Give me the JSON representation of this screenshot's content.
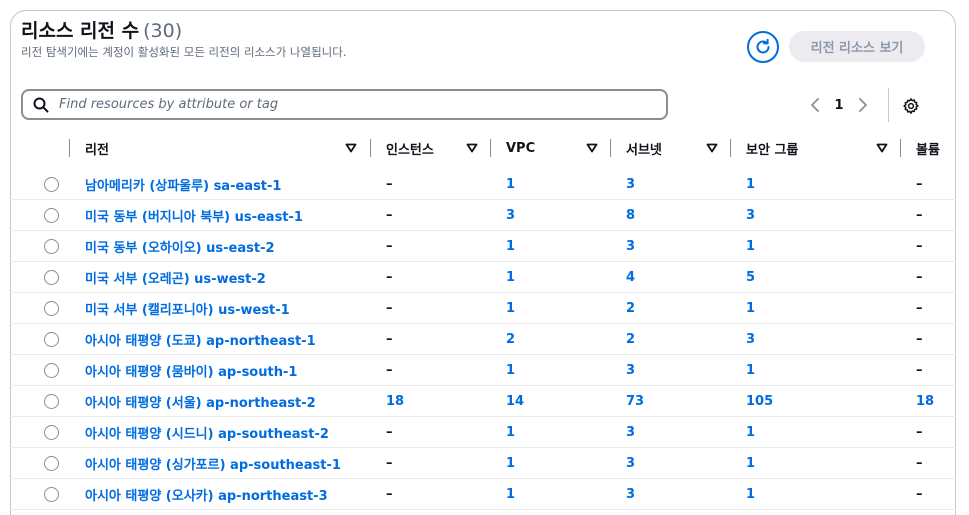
{
  "header": {
    "title": "리소스 리전 수",
    "count": "(30)",
    "description": "리전 탐색기에는 계정이 활성화된 모든 리전의 리소스가 나열됩니다.",
    "view_button_label": "리전 리소스 보기"
  },
  "search": {
    "placeholder": "Find resources by attribute or tag",
    "value": ""
  },
  "pagination": {
    "current_page": "1"
  },
  "colors": {
    "link": "#006ce0",
    "disabled_button_bg": "#ebebf0"
  },
  "table": {
    "columns": [
      "리전",
      "인스턴스",
      "VPC",
      "서브넷",
      "보안 그룹",
      "볼륨"
    ],
    "rows": [
      {
        "region": "남아메리카 (상파울루) sa-east-1",
        "instances": "–",
        "vpc": "1",
        "subnets": "3",
        "security_groups": "1",
        "volumes": "–"
      },
      {
        "region": "미국 동부 (버지니아 북부) us-east-1",
        "instances": "–",
        "vpc": "3",
        "subnets": "8",
        "security_groups": "3",
        "volumes": "–"
      },
      {
        "region": "미국 동부 (오하이오) us-east-2",
        "instances": "–",
        "vpc": "1",
        "subnets": "3",
        "security_groups": "1",
        "volumes": "–"
      },
      {
        "region": "미국 서부 (오레곤) us-west-2",
        "instances": "–",
        "vpc": "1",
        "subnets": "4",
        "security_groups": "5",
        "volumes": "–"
      },
      {
        "region": "미국 서부 (캘리포니아) us-west-1",
        "instances": "–",
        "vpc": "1",
        "subnets": "2",
        "security_groups": "1",
        "volumes": "–"
      },
      {
        "region": "아시아 태평양 (도쿄) ap-northeast-1",
        "instances": "–",
        "vpc": "2",
        "subnets": "2",
        "security_groups": "3",
        "volumes": "–"
      },
      {
        "region": "아시아 태평양 (뭄바이) ap-south-1",
        "instances": "–",
        "vpc": "1",
        "subnets": "3",
        "security_groups": "1",
        "volumes": "–"
      },
      {
        "region": "아시아 태평양 (서울) ap-northeast-2",
        "instances": "18",
        "vpc": "14",
        "subnets": "73",
        "security_groups": "105",
        "volumes": "18"
      },
      {
        "region": "아시아 태평양 (시드니) ap-southeast-2",
        "instances": "–",
        "vpc": "1",
        "subnets": "3",
        "security_groups": "1",
        "volumes": "–"
      },
      {
        "region": "아시아 태평양 (싱가포르) ap-southeast-1",
        "instances": "–",
        "vpc": "1",
        "subnets": "3",
        "security_groups": "1",
        "volumes": "–"
      },
      {
        "region": "아시아 태평양 (오사카) ap-northeast-3",
        "instances": "–",
        "vpc": "1",
        "subnets": "3",
        "security_groups": "1",
        "volumes": "–"
      }
    ]
  }
}
